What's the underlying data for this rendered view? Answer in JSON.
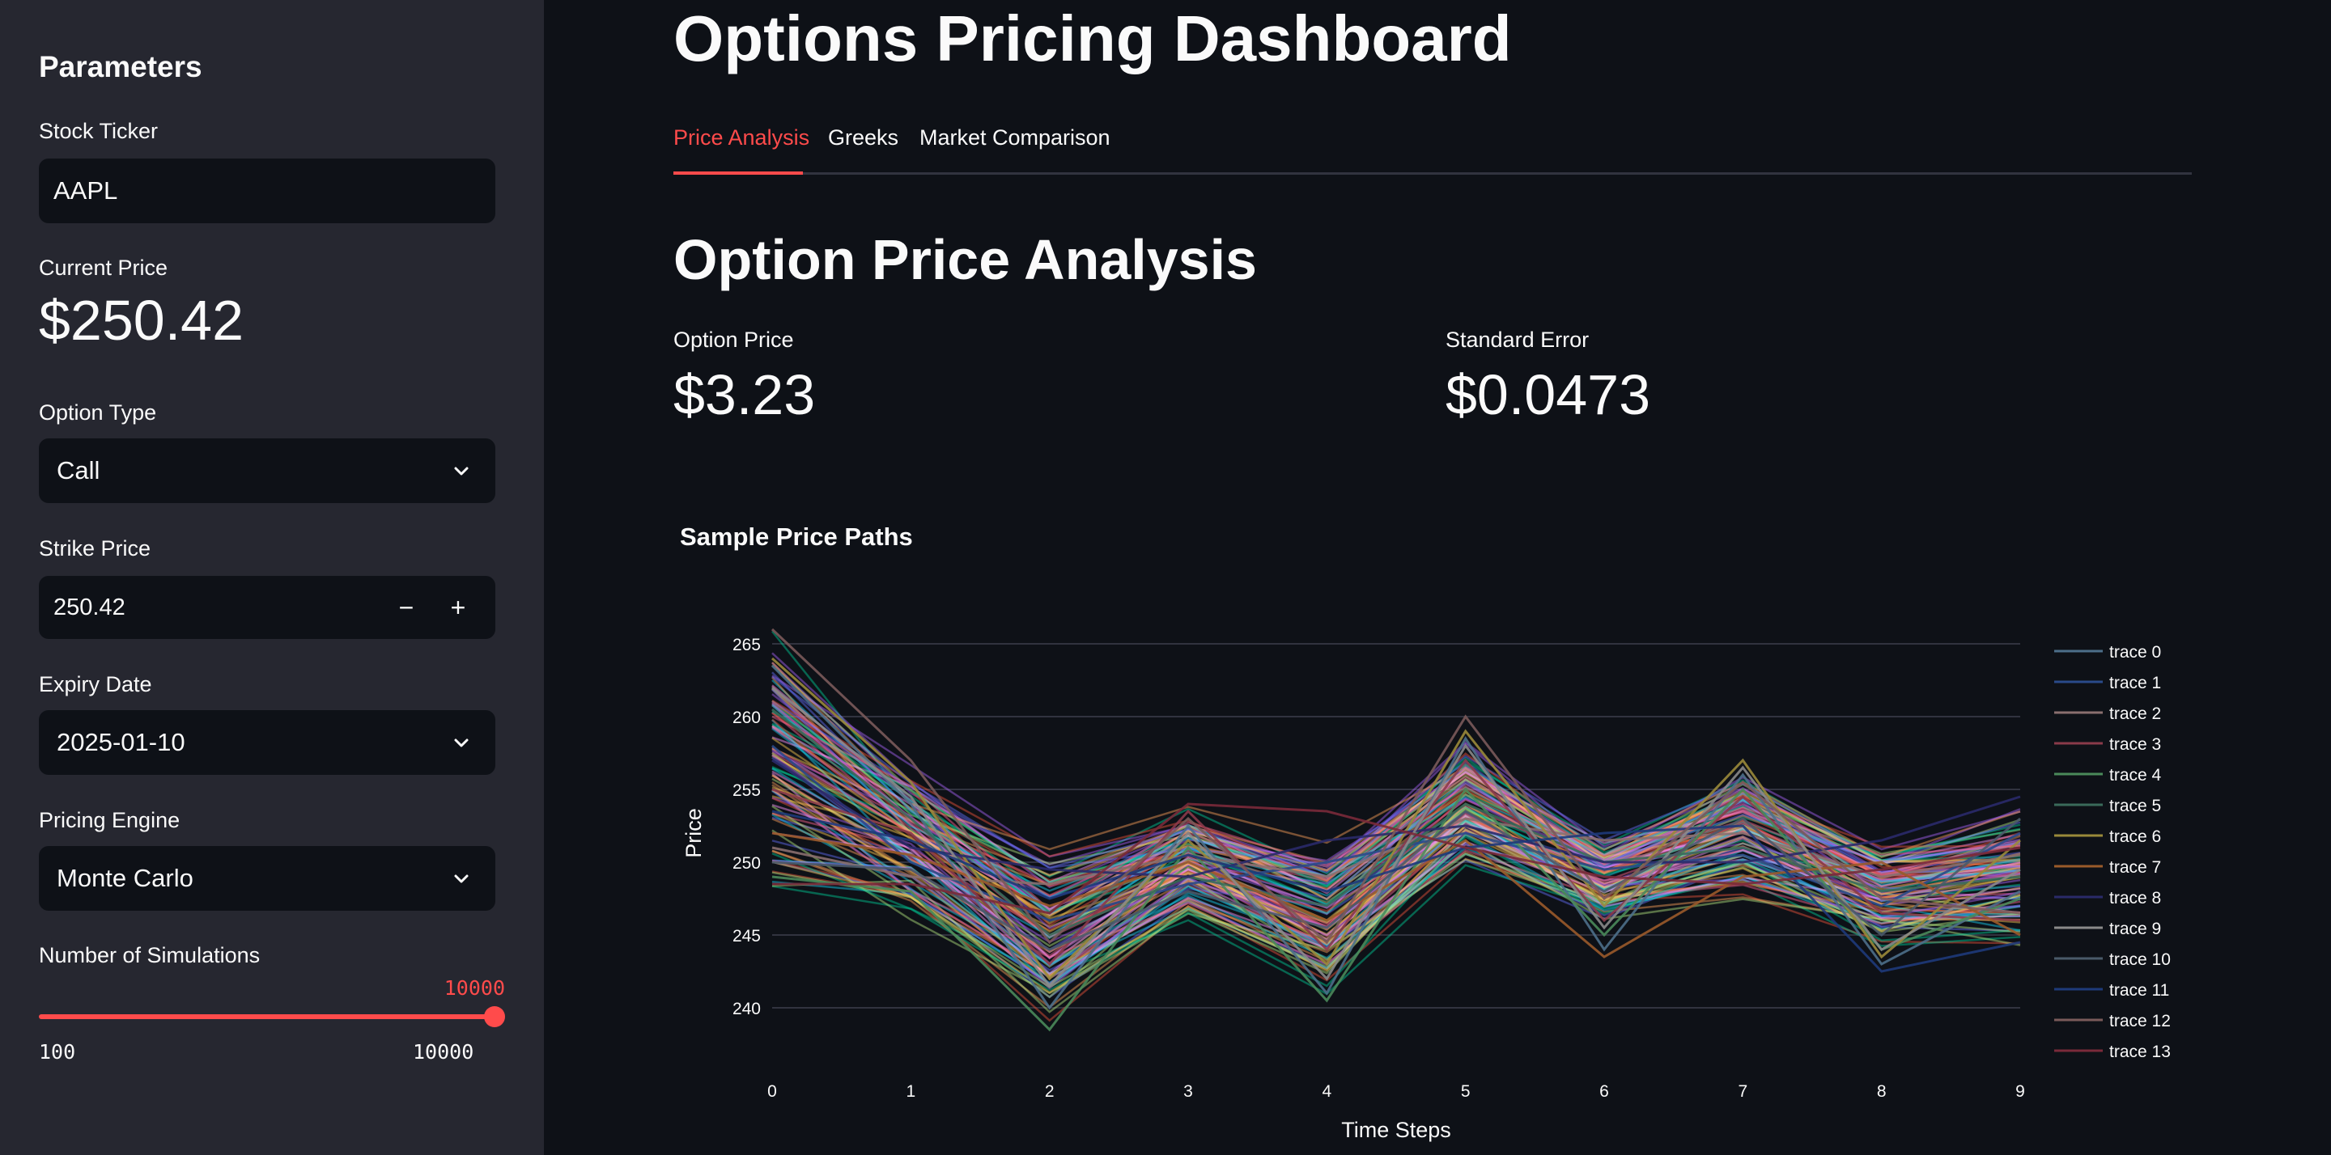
{
  "sidebar": {
    "title": "Parameters",
    "ticker_label": "Stock Ticker",
    "ticker_value": "AAPL",
    "current_price_label": "Current Price",
    "current_price_value": "$250.42",
    "option_type_label": "Option Type",
    "option_type_value": "Call",
    "strike_label": "Strike Price",
    "strike_value": "250.42",
    "strike_minus": "−",
    "strike_plus": "+",
    "expiry_label": "Expiry Date",
    "expiry_value": "2025-01-10",
    "engine_label": "Pricing Engine",
    "engine_value": "Monte Carlo",
    "sims_label": "Number of Simulations",
    "sims_value": "10000",
    "sims_min": "100",
    "sims_max": "10000"
  },
  "main": {
    "title": "Options Pricing Dashboard",
    "tabs": [
      {
        "label": "Price Analysis",
        "active": true
      },
      {
        "label": "Greeks",
        "active": false
      },
      {
        "label": "Market Comparison",
        "active": false
      }
    ],
    "section_title": "Option Price Analysis",
    "metrics": [
      {
        "label": "Option Price",
        "value": "$3.23"
      },
      {
        "label": "Standard Error",
        "value": "$0.0473"
      }
    ]
  },
  "colors": {
    "accent": "#ff4b4b",
    "sidebar_bg": "#262730",
    "main_bg": "#0e1117"
  },
  "chart_data": {
    "type": "line",
    "title": "Sample Price Paths",
    "xlabel": "Time Steps",
    "ylabel": "Price",
    "x": [
      0,
      1,
      2,
      3,
      4,
      5,
      6,
      7,
      8,
      9
    ],
    "xlim": [
      0,
      9
    ],
    "ylim": [
      237,
      267
    ],
    "yticks": [
      240,
      245,
      250,
      255,
      260,
      265
    ],
    "grid": true,
    "legend_position": "right",
    "series": [
      {
        "name": "trace 0",
        "color": "#4c6f8a",
        "values": [
          263.5,
          254.0,
          240.0,
          252.5,
          241.0,
          258.5,
          244.0,
          256.0,
          243.0,
          248.0
        ]
      },
      {
        "name": "trace 1",
        "color": "#2a4a8a",
        "values": [
          258.0,
          250.0,
          246.0,
          248.5,
          250.0,
          252.0,
          249.5,
          250.5,
          247.0,
          252.0
        ]
      },
      {
        "name": "trace 2",
        "color": "#8a6f6f",
        "values": [
          251.0,
          249.0,
          248.5,
          250.5,
          249.0,
          253.0,
          251.5,
          252.0,
          249.0,
          250.5
        ]
      },
      {
        "name": "trace 3",
        "color": "#8a3a4a",
        "values": [
          255.0,
          252.0,
          243.0,
          253.5,
          244.0,
          257.0,
          246.0,
          254.5,
          246.5,
          246.0
        ]
      },
      {
        "name": "trace 4",
        "color": "#4a8a5a",
        "values": [
          249.0,
          248.0,
          238.5,
          251.0,
          240.5,
          255.0,
          245.0,
          255.0,
          244.0,
          247.5
        ]
      },
      {
        "name": "trace 5",
        "color": "#3a6a5a",
        "values": [
          260.5,
          253.0,
          245.0,
          249.0,
          247.0,
          254.0,
          250.0,
          251.0,
          248.0,
          249.0
        ]
      },
      {
        "name": "trace 6",
        "color": "#9a8a3a",
        "values": [
          264.0,
          255.5,
          242.0,
          251.5,
          243.0,
          259.0,
          247.0,
          257.0,
          243.5,
          251.5
        ]
      },
      {
        "name": "trace 7",
        "color": "#9a5a2a",
        "values": [
          252.0,
          250.5,
          247.0,
          250.0,
          246.0,
          251.5,
          243.5,
          249.0,
          250.0,
          245.0
        ]
      },
      {
        "name": "trace 8",
        "color": "#2a2a6a",
        "values": [
          257.0,
          251.0,
          249.5,
          249.0,
          251.5,
          252.5,
          250.0,
          250.0,
          251.5,
          254.5
        ]
      },
      {
        "name": "trace 9",
        "color": "#8a8a8a",
        "values": [
          262.0,
          254.5,
          241.5,
          252.0,
          242.0,
          258.0,
          245.5,
          256.5,
          244.0,
          249.5
        ]
      },
      {
        "name": "trace 10",
        "color": "#4a5a6a",
        "values": [
          250.0,
          249.5,
          244.0,
          248.0,
          245.5,
          253.5,
          248.0,
          253.0,
          245.0,
          253.0
        ]
      },
      {
        "name": "trace 11",
        "color": "#1e3a7a",
        "values": [
          253.5,
          251.5,
          247.5,
          250.5,
          248.0,
          251.0,
          252.0,
          252.5,
          242.5,
          244.5
        ]
      },
      {
        "name": "trace 12",
        "color": "#7a5a5a",
        "values": [
          266.0,
          257.0,
          244.5,
          253.0,
          244.5,
          260.0,
          247.5,
          255.5,
          247.5,
          246.5
        ]
      },
      {
        "name": "trace 13",
        "color": "#7a2a3a",
        "values": [
          248.5,
          248.5,
          246.5,
          254.0,
          253.5,
          251.0,
          249.0,
          248.5,
          249.5,
          251.0
        ]
      }
    ]
  }
}
